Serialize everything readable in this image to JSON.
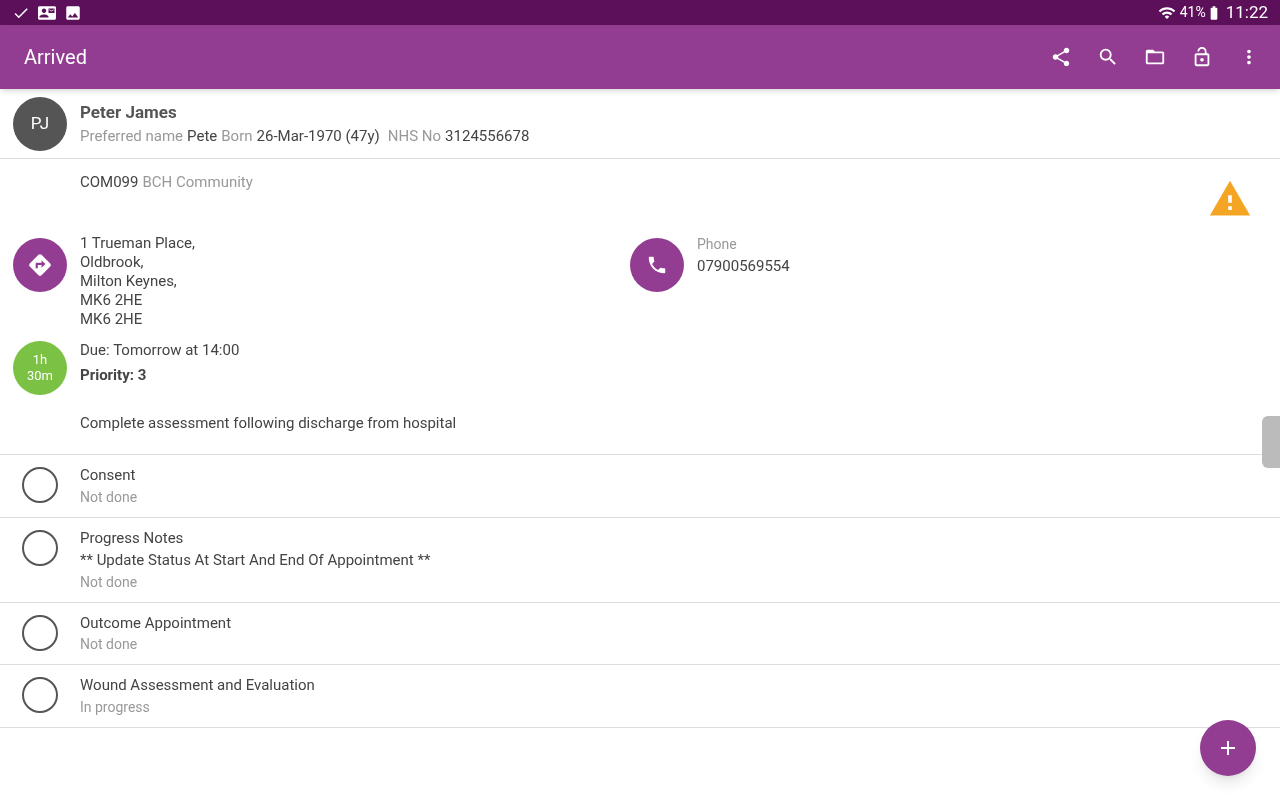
{
  "status_bar": {
    "battery": "41%",
    "time": "11:22"
  },
  "app_bar": {
    "title": "Arrived"
  },
  "patient": {
    "initials": "PJ",
    "name": "Peter James",
    "preferred_label": "Preferred name",
    "preferred": "Pete",
    "born_label": "Born",
    "born": "26-Mar-1970 (47y)",
    "nhs_label": "NHS No",
    "nhs": "3124556678"
  },
  "service": {
    "code": "COM099",
    "name": "BCH Community"
  },
  "address": [
    "1 Trueman Place,",
    "Oldbrook,",
    "Milton Keynes,",
    "MK6 2HE",
    "MK6 2HE"
  ],
  "phone": {
    "label": "Phone",
    "number": "07900569554"
  },
  "appointment": {
    "duration": [
      "1h",
      "30m"
    ],
    "due": "Due: Tomorrow at 14:00",
    "priority": "Priority: 3",
    "description": "Complete assessment following discharge from hospital"
  },
  "tasks": [
    {
      "title": "Consent",
      "status": "Not done",
      "checked": false
    },
    {
      "title": "Progress Notes",
      "note": "**  Update Status At Start And End Of Appointment **",
      "status": "Not done",
      "checked": false
    },
    {
      "title": "Outcome Appointment",
      "status": "Not done",
      "checked": false
    },
    {
      "title": "Wound Assessment and Evaluation",
      "status": "In progress",
      "checked": false
    }
  ]
}
